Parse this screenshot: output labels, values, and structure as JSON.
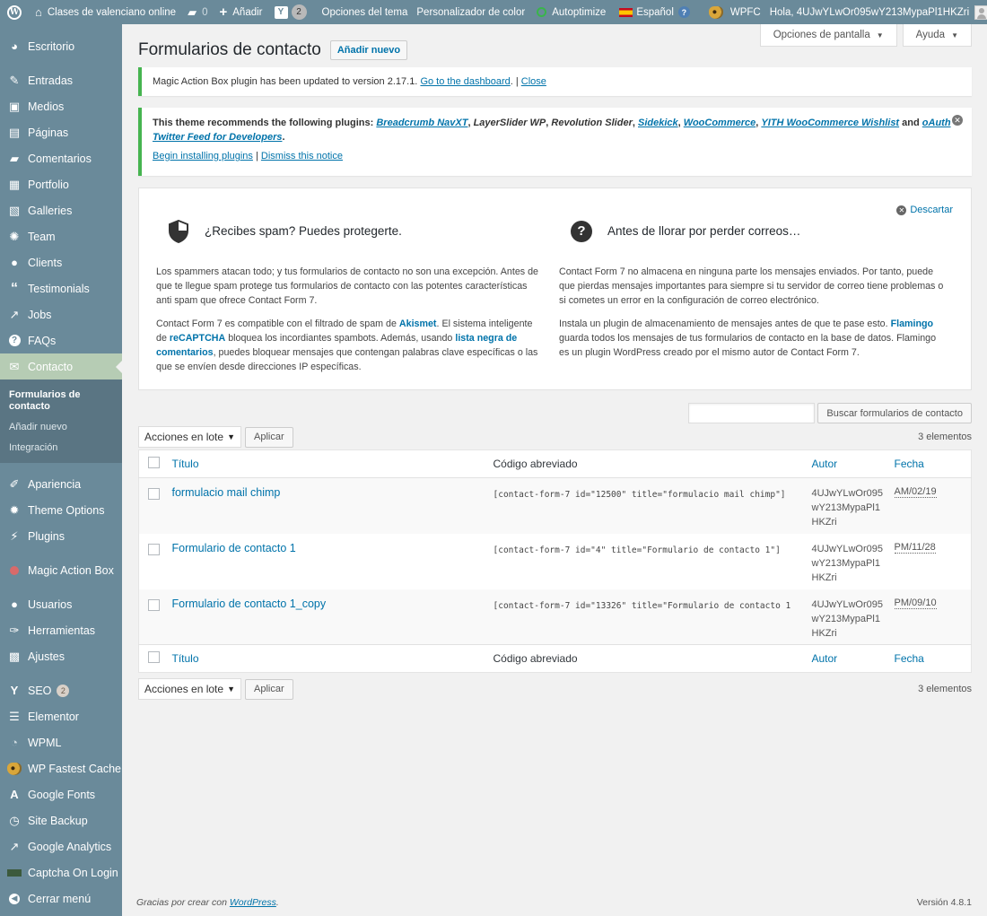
{
  "adminbar": {
    "site_name": "Clases de valenciano online",
    "comments_count": "0",
    "new_label": "Añadir",
    "yoast_count": "2",
    "theme_options": "Opciones del tema",
    "color_customizer": "Personalizador de color",
    "autoptimize": "Autoptimize",
    "language": "Español",
    "wpfc": "WPFC",
    "greeting": "Hola, 4UJwYLwOr095wY213MypaPl1HKZri"
  },
  "sidebar": {
    "items": [
      {
        "label": "Escritorio",
        "icon": "dashboard-icon"
      },
      {
        "label": "Entradas",
        "icon": "pin-icon"
      },
      {
        "label": "Medios",
        "icon": "media-icon"
      },
      {
        "label": "Páginas",
        "icon": "page-icon"
      },
      {
        "label": "Comentarios",
        "icon": "comment-icon"
      },
      {
        "label": "Portfolio",
        "icon": "portfolio-icon"
      },
      {
        "label": "Galleries",
        "icon": "gallery-icon"
      },
      {
        "label": "Team",
        "icon": "team-icon"
      },
      {
        "label": "Clients",
        "icon": "user-icon"
      },
      {
        "label": "Testimonials",
        "icon": "quote-icon"
      },
      {
        "label": "Jobs",
        "icon": "hammer-icon"
      },
      {
        "label": "FAQs",
        "icon": "help-icon"
      },
      {
        "label": "Contacto",
        "icon": "mail-icon"
      },
      {
        "label": "Apariencia",
        "icon": "brush-icon"
      },
      {
        "label": "Theme Options",
        "icon": "gear-icon"
      },
      {
        "label": "Plugins",
        "icon": "plug-icon"
      },
      {
        "label": "Magic Action Box",
        "icon": "magic-box-icon"
      },
      {
        "label": "Usuarios",
        "icon": "users-icon"
      },
      {
        "label": "Herramientas",
        "icon": "wrench-icon"
      },
      {
        "label": "Ajustes",
        "icon": "settings-icon"
      },
      {
        "label": "SEO",
        "icon": "yoast-icon",
        "badge": "2"
      },
      {
        "label": "Elementor",
        "icon": "elementor-icon"
      },
      {
        "label": "WPML",
        "icon": "wpml-icon"
      },
      {
        "label": "WP Fastest Cache",
        "icon": "cheetah-icon"
      },
      {
        "label": "Google Fonts",
        "icon": "font-icon"
      },
      {
        "label": "Site Backup",
        "icon": "backup-icon"
      },
      {
        "label": "Google Analytics",
        "icon": "analytics-icon"
      },
      {
        "label": "Captcha On Login",
        "icon": "captcha-icon"
      },
      {
        "label": "Cerrar menú",
        "icon": "collapse-icon"
      }
    ],
    "submenu": [
      "Formularios de contacto",
      "Añadir nuevo",
      "Integración"
    ]
  },
  "screen_options": "Opciones de pantalla",
  "help": "Ayuda",
  "page": {
    "title": "Formularios de contacto",
    "add_new": "Añadir nuevo"
  },
  "notice1": {
    "text": "Magic Action Box plugin has been updated to version 2.17.1.",
    "link1": "Go to the dashboard",
    "sep": ".",
    "bar": "|",
    "link2": "Close"
  },
  "notice2": {
    "intro": "This theme recommends the following plugins:",
    "p1": "Breadcrumb NavXT",
    "p2": "LayerSlider WP",
    "p3": "Revolution Slider",
    "p4": "Sidekick",
    "p5": "WooCommerce",
    "p6": "YITH WooCommerce Wishlist",
    "and": "and",
    "p7": "oAuth Twitter Feed for Developers",
    "begin": "Begin installing plugins",
    "bar": "|",
    "dismiss": "Dismiss this notice"
  },
  "cf7": {
    "dismiss": "Descartar",
    "left": {
      "title": "¿Recibes spam? Puedes protegerte.",
      "p1": "Los spammers atacan todo; y tus formularios de contacto no son una excepción. Antes de que te llegue spam protege tus formularios de contacto con las potentes características anti spam que ofrece Contact Form 7.",
      "p2a": "Contact Form 7 es compatible con el filtrado de spam de",
      "akismet": "Akismet",
      "p2b": ". El sistema inteligente de",
      "recaptcha": "reCAPTCHA",
      "p2c": "bloquea los incordiantes spambots. Además, usando",
      "blacklist": "lista negra de comentarios",
      "p2d": ", puedes bloquear mensajes que contengan palabras clave específicas o las que se envíen desde direcciones IP específicas."
    },
    "right": {
      "title": "Antes de llorar por perder correos…",
      "p1": "Contact Form 7 no almacena en ninguna parte los mensajes enviados. Por tanto, puede que pierdas mensajes importantes para siempre si tu servidor de correo tiene problemas o si cometes un error en la configuración de correo electrónico.",
      "p2a": "Instala un plugin de almacenamiento de mensajes antes de que te pase esto.",
      "flamingo": "Flamingo",
      "p2b": "guarda todos los mensajes de tus formularios de contacto en la base de datos. Flamingo es un plugin WordPress creado por el mismo autor de Contact Form 7."
    }
  },
  "search_button": "Buscar formularios de contacto",
  "bulk": {
    "selected": "Acciones en lote",
    "apply": "Aplicar"
  },
  "count": "3 elementos",
  "table": {
    "columns": {
      "title": "Título",
      "shortcode": "Código abreviado",
      "author": "Autor",
      "date": "Fecha"
    },
    "rows": [
      {
        "title": "formulacio mail chimp",
        "shortcode": "[contact-form-7 id=\"12500\" title=\"formulacio mail chimp\"]",
        "author_l1": "4UJwYLwOr095",
        "author_l2": "wY213MypaPl1",
        "author_l3": "HKZri",
        "date": "AM/02/19"
      },
      {
        "title": "Formulario de contacto 1",
        "shortcode": "[contact-form-7 id=\"4\" title=\"Formulario de contacto 1\"]",
        "author_l1": "4UJwYLwOr095",
        "author_l2": "wY213MypaPl1",
        "author_l3": "HKZri",
        "date": "PM/11/28"
      },
      {
        "title": "Formulario de contacto 1_copy",
        "shortcode": "[contact-form-7 id=\"13326\" title=\"Formulario de contacto 1",
        "author_l1": "4UJwYLwOr095",
        "author_l2": "wY213MypaPl1",
        "author_l3": "HKZri",
        "date": "PM/09/10"
      }
    ]
  },
  "footer": {
    "thanks": "Gracias por crear con",
    "wp_link": "WordPress",
    "dot": ".",
    "version": "Versión 4.8.1"
  }
}
